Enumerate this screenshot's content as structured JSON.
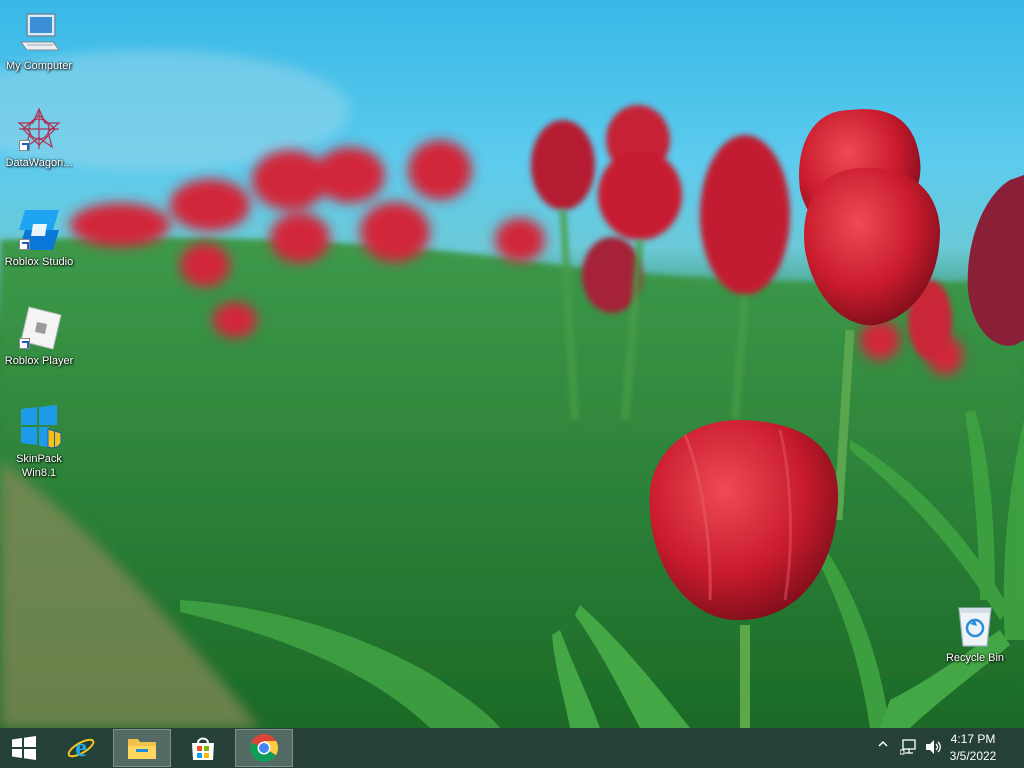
{
  "desktop": {
    "icons": [
      {
        "label": "My Computer",
        "icon": "computer-icon"
      },
      {
        "label": "DataWagon...",
        "icon": "datawagon-icon"
      },
      {
        "label": "Roblox Studio",
        "icon": "roblox-studio-icon"
      },
      {
        "label": "Roblox Player",
        "icon": "roblox-player-icon"
      },
      {
        "label": "SkinPack Win8.1",
        "icon": "skinpack-icon"
      },
      {
        "label": "Recycle Bin",
        "icon": "recycle-bin-icon"
      }
    ],
    "wallpaper": "red tulips on green field under blue sky"
  },
  "taskbar": {
    "items": [
      {
        "name": "start-button",
        "icon": "windows-logo-icon"
      },
      {
        "name": "internet-explorer",
        "icon": "ie-icon"
      },
      {
        "name": "file-explorer",
        "icon": "folder-icon",
        "active": true
      },
      {
        "name": "store",
        "icon": "store-icon"
      },
      {
        "name": "chrome",
        "icon": "chrome-icon",
        "active": true
      }
    ],
    "tray": {
      "time": "4:17 PM",
      "date": "3/5/2022"
    }
  },
  "colors": {
    "taskbar": "#123028",
    "sky": "#37b8e6",
    "tulip": "#c8202e"
  }
}
